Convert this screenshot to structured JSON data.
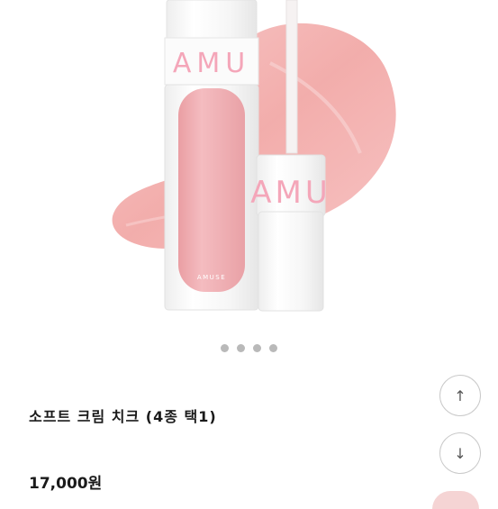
{
  "product": {
    "brand_top": "AMUSE",
    "brand_tube": "AMUSE",
    "cap_letters": "AMU",
    "wand_letters": "AMU",
    "title": "소프트 크림 치크 (4종 택1)",
    "price": "17,000원"
  },
  "carousel": {
    "page_count": 4
  },
  "icons": {
    "scroll_up": "↑",
    "scroll_down": "↓"
  },
  "colors": {
    "swatch_pink": "#f2a6a6",
    "tube_pink": "#f1b3b6",
    "letters_pink": "#f4a6b9"
  }
}
